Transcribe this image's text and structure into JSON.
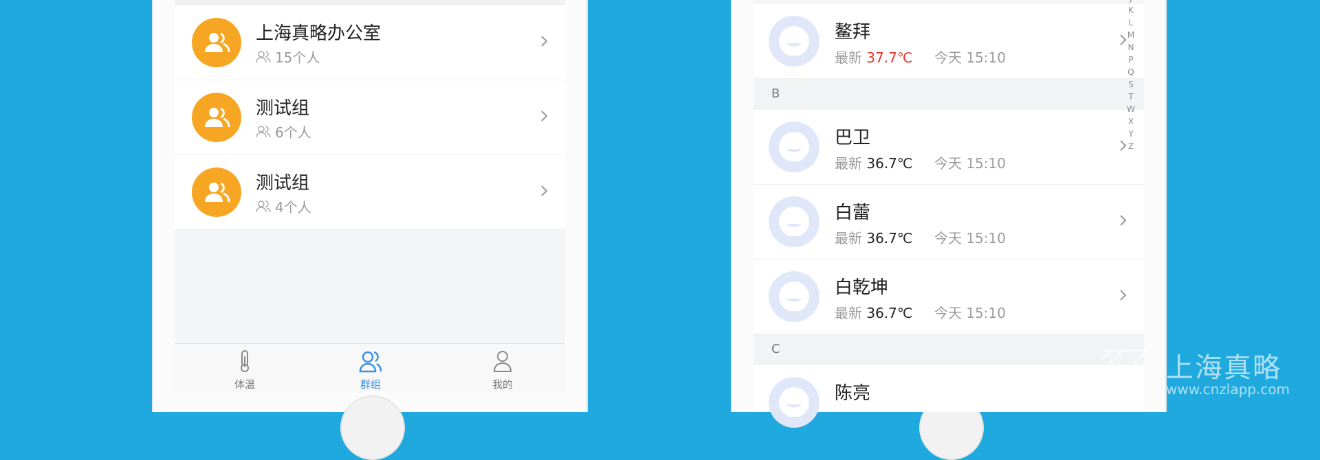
{
  "groups_screen": {
    "groups": [
      {
        "name": "上海真略办公室",
        "count": "15个人"
      },
      {
        "name": "测试组",
        "count": "6个人"
      },
      {
        "name": "测试组",
        "count": "4个人"
      }
    ],
    "tabbar": [
      {
        "label": "体温",
        "icon": "thermometer-icon",
        "active": false
      },
      {
        "label": "群组",
        "icon": "group-icon",
        "active": true
      },
      {
        "label": "我的",
        "icon": "person-icon",
        "active": false
      }
    ]
  },
  "contacts_screen": {
    "contacts": [
      {
        "name": "鳌拜",
        "latest_label": "最新",
        "temp": "37.7℃",
        "time": "今天 15:10",
        "fever": true
      },
      {
        "name": "巴卫",
        "latest_label": "最新",
        "temp": "36.7℃",
        "time": "今天 15:10",
        "fever": false
      },
      {
        "name": "白蕾",
        "latest_label": "最新",
        "temp": "36.7℃",
        "time": "今天 15:10",
        "fever": false
      },
      {
        "name": "白乾坤",
        "latest_label": "最新",
        "temp": "36.7℃",
        "time": "今天 15:10",
        "fever": false
      },
      {
        "name": "陈亮",
        "latest_label": "",
        "temp": "",
        "time": "",
        "fever": false
      }
    ],
    "sections": [
      "B",
      "C"
    ],
    "index_letters": [
      "J",
      "K",
      "L",
      "M",
      "N",
      "P",
      "Q",
      "S",
      "T",
      "W",
      "X",
      "Y",
      "Z"
    ]
  },
  "watermark": {
    "title": "上海真略",
    "url": "www.cnzlapp.com"
  },
  "colors": {
    "background": "#1fa9de",
    "group_avatar": "#f6a623",
    "active_tab": "#3a90e6",
    "fever_temp": "#e0332c"
  }
}
